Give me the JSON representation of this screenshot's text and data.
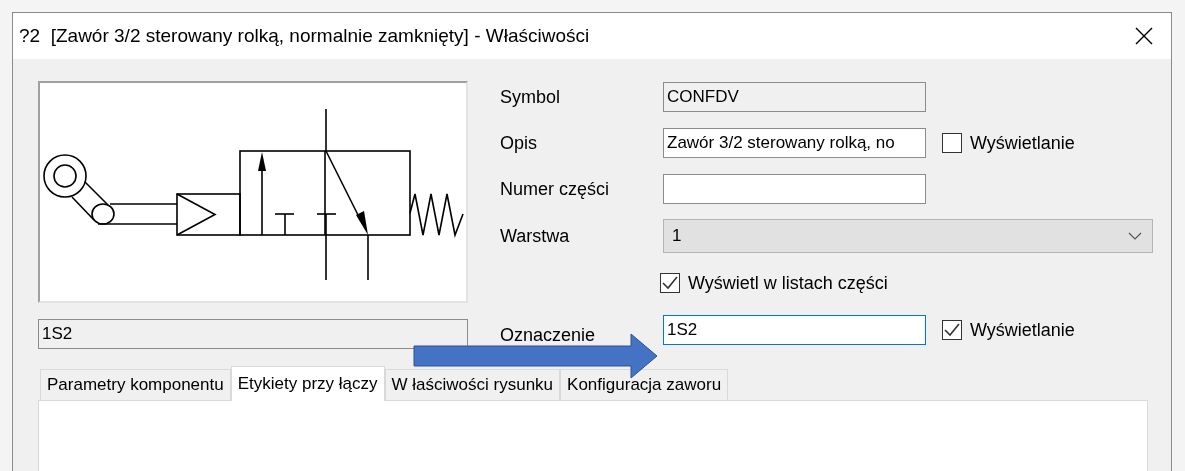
{
  "window": {
    "title": "?2  [Zawór 3/2 sterowany rolką, normalnie zamknięty] - Właściwości"
  },
  "name_field": {
    "value": "1S2"
  },
  "fields": [
    {
      "kind": "text",
      "label": "Symbol",
      "value": "CONFDV",
      "disabled": true
    },
    {
      "kind": "text",
      "label": "Opis",
      "value": "Zawór 3/2 sterowany rolką, no",
      "disabled": false,
      "display": {
        "label": "Wyświetlanie",
        "checked": false
      }
    },
    {
      "kind": "text",
      "label": "Numer części",
      "disabled": false
    },
    {
      "kind": "select",
      "label": "Warstwa",
      "value": "1"
    },
    {
      "kind": "checkbox",
      "label": "Wyświetl w listach części",
      "checked": true
    },
    {
      "kind": "text",
      "label": "Oznaczenie",
      "value": "1S2",
      "disabled": false,
      "focused": true,
      "display": {
        "label": "Wyświetlanie",
        "checked": true
      }
    }
  ],
  "tabs": [
    {
      "label": "Parametry komponentu",
      "selected": false
    },
    {
      "label": "Etykiety przy łączy",
      "selected": true
    },
    {
      "label": "W łaściwości rysunku",
      "selected": false
    },
    {
      "label": "Konfiguracja zaworu",
      "selected": false
    }
  ]
}
